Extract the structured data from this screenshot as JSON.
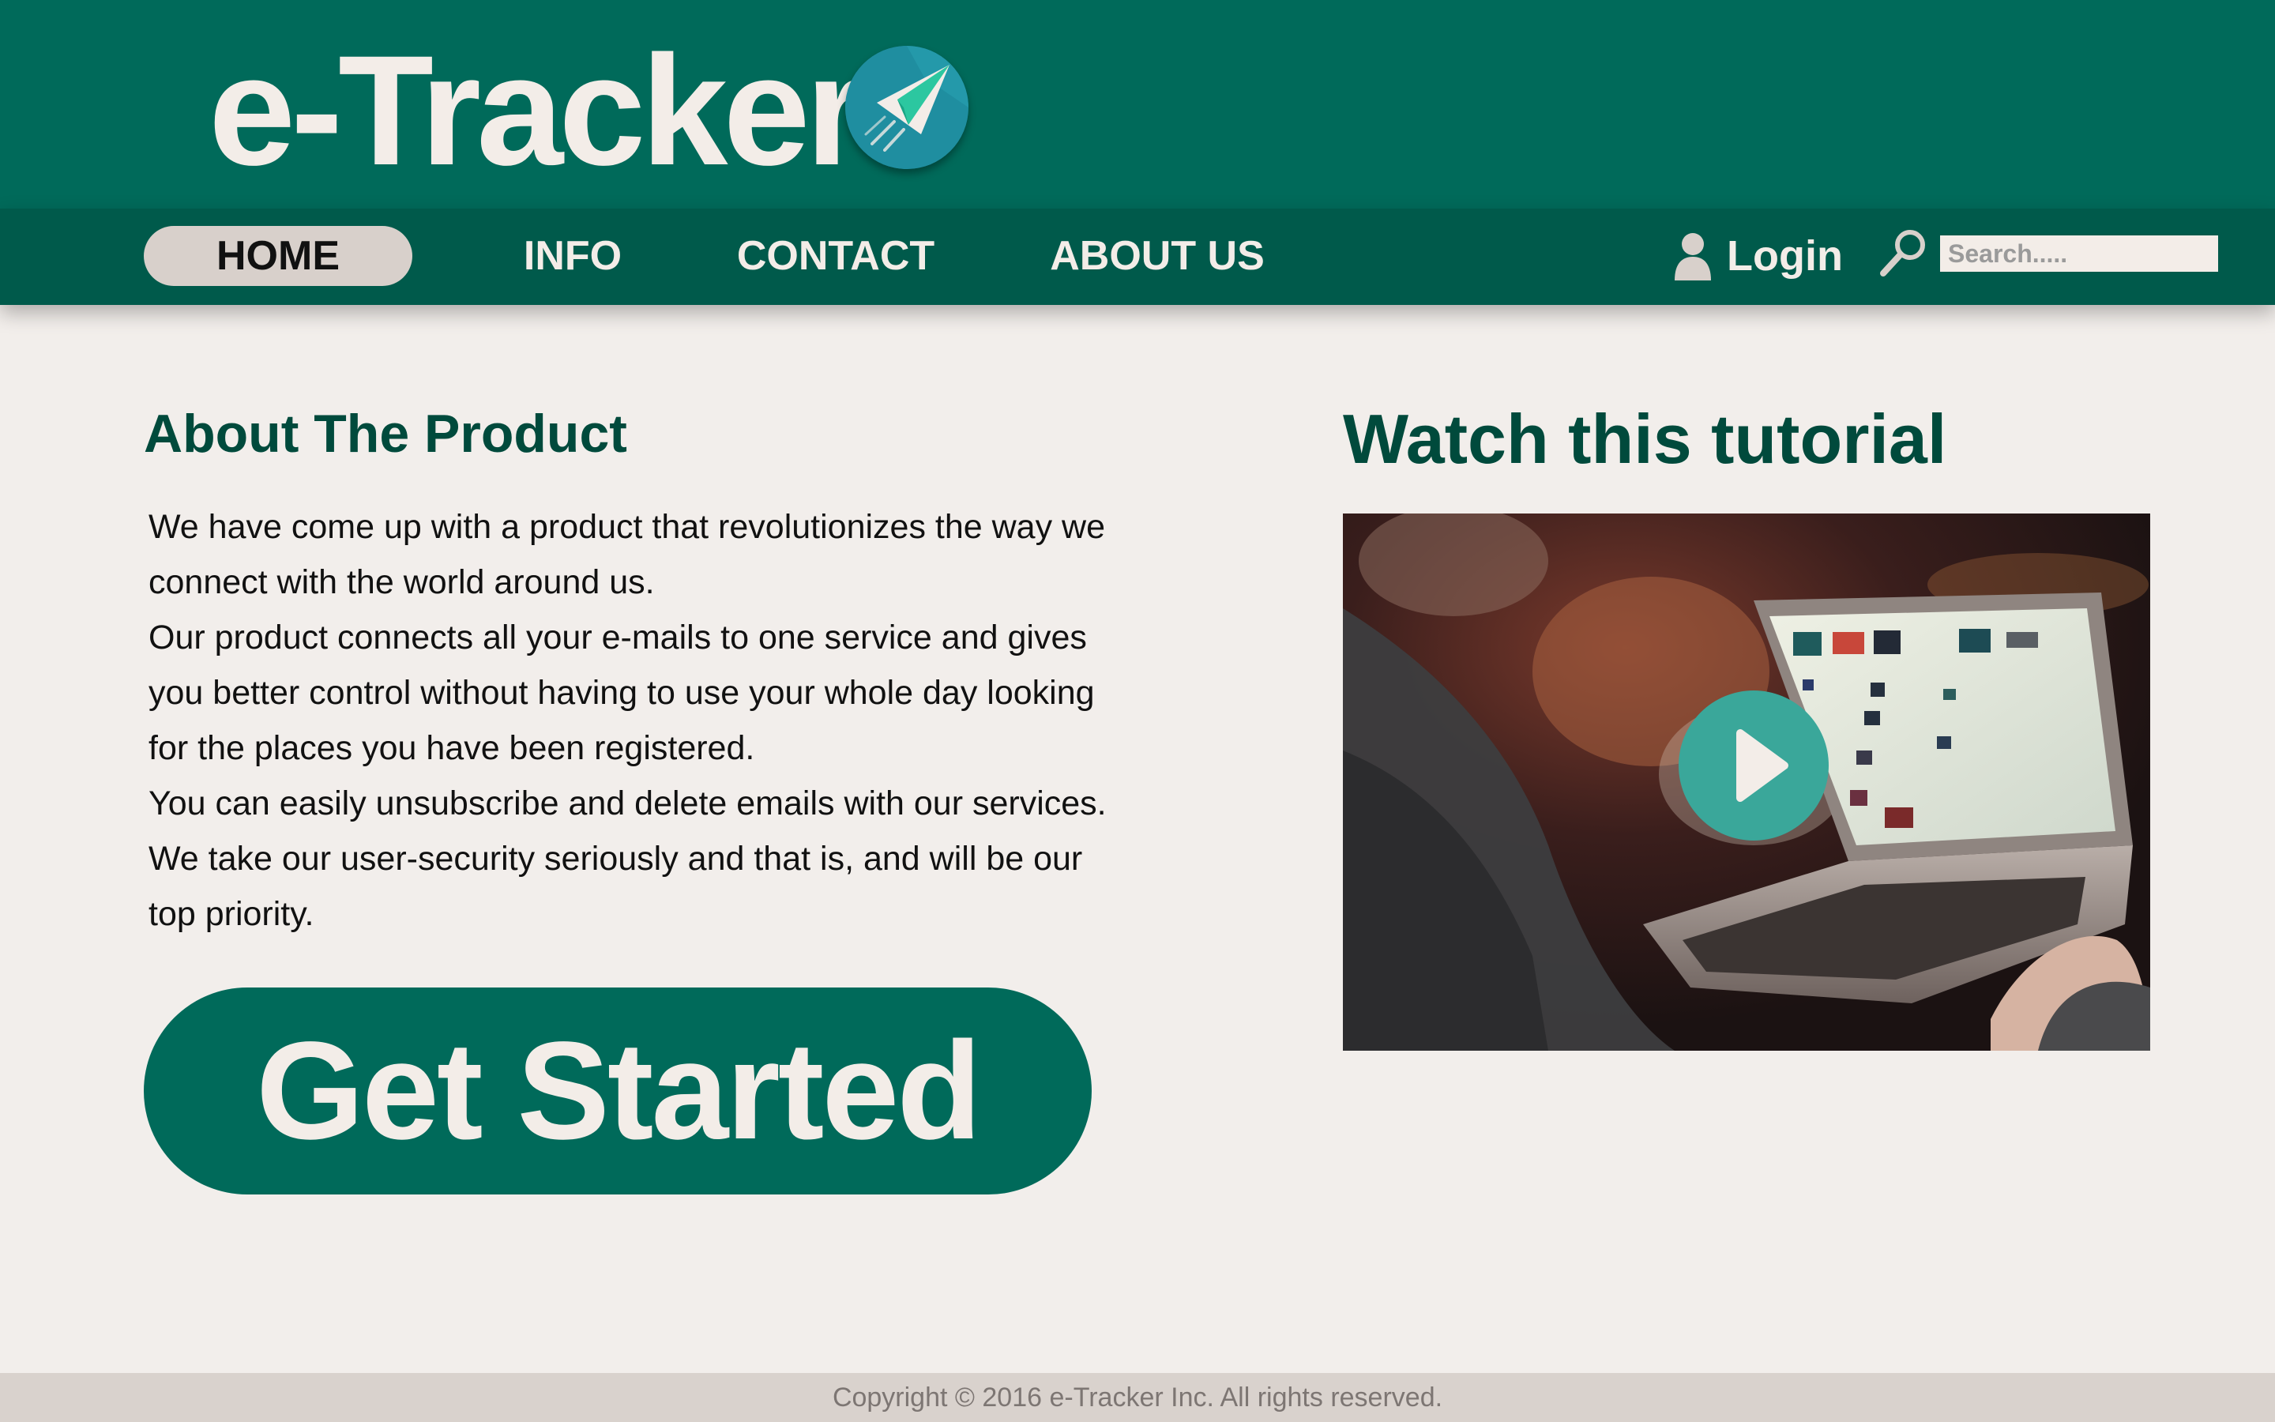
{
  "brand": {
    "name": "e-Tracker",
    "logo_icon": "paper-plane-icon"
  },
  "nav": {
    "items": [
      {
        "label": "HOME",
        "active": true
      },
      {
        "label": "INFO",
        "active": false
      },
      {
        "label": "CONTACT",
        "active": false
      },
      {
        "label": "ABOUT US",
        "active": false
      }
    ],
    "login_label": "Login",
    "login_icon": "user-icon",
    "search_icon": "search-icon",
    "search_placeholder": "Search....."
  },
  "about": {
    "title": "About The Product",
    "paragraphs": [
      "We have come up with a product that revolutionizes the way we connect with the world around us.",
      "Our product connects all your e-mails to one service and gives you better control without having to use your whole day looking for the places you have been registered.",
      "You can easily unsubscribe and delete emails with our services.",
      "We take our user-security seriously and that is, and will be our top priority."
    ],
    "cta_label": "Get Started"
  },
  "tutorial": {
    "title": "Watch this tutorial",
    "play_icon": "play-icon"
  },
  "footer": {
    "copyright": "Copyright © 2016 e-Tracker Inc. All rights reserved."
  },
  "colors": {
    "header": "#006a5a",
    "navbar": "#005a4b",
    "page_background": "#f2eeeb",
    "heading": "#004a3c",
    "active_tab": "#d8d0cb",
    "play_button": "#3aa79a",
    "footer": "#d9d2cd"
  }
}
